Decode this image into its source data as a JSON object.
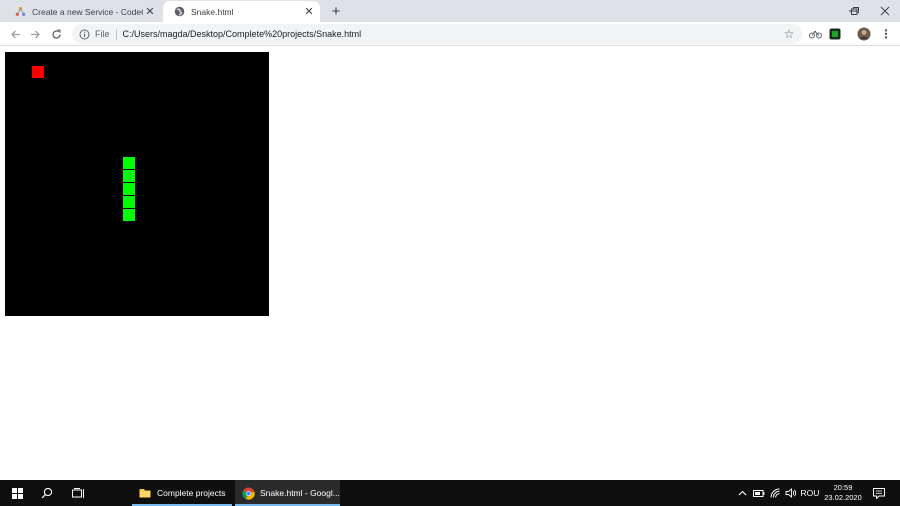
{
  "browser": {
    "tabs": [
      {
        "title": "Create a new Service - CodeClerk",
        "active": false
      },
      {
        "title": "Snake.html",
        "active": true
      }
    ],
    "address_bar": {
      "scheme_label": "File",
      "url": "C:/Users/magda/Desktop/Complete%20projects/Snake.html"
    }
  },
  "game": {
    "background_color": "#000000",
    "food": {
      "color": "#ff0000",
      "cell": [
        2,
        1
      ]
    },
    "snake": {
      "color": "#00ff00",
      "cells": [
        [
          9,
          8
        ],
        [
          9,
          9
        ],
        [
          9,
          10
        ],
        [
          9,
          11
        ],
        [
          9,
          12
        ]
      ]
    }
  },
  "taskbar": {
    "apps": [
      {
        "label": "Complete projects",
        "icon": "folder-icon"
      },
      {
        "label": "Snake.html - Googl...",
        "icon": "chrome-icon"
      }
    ],
    "language": "ROU",
    "time": "20:59",
    "date": "23.02.2020"
  }
}
